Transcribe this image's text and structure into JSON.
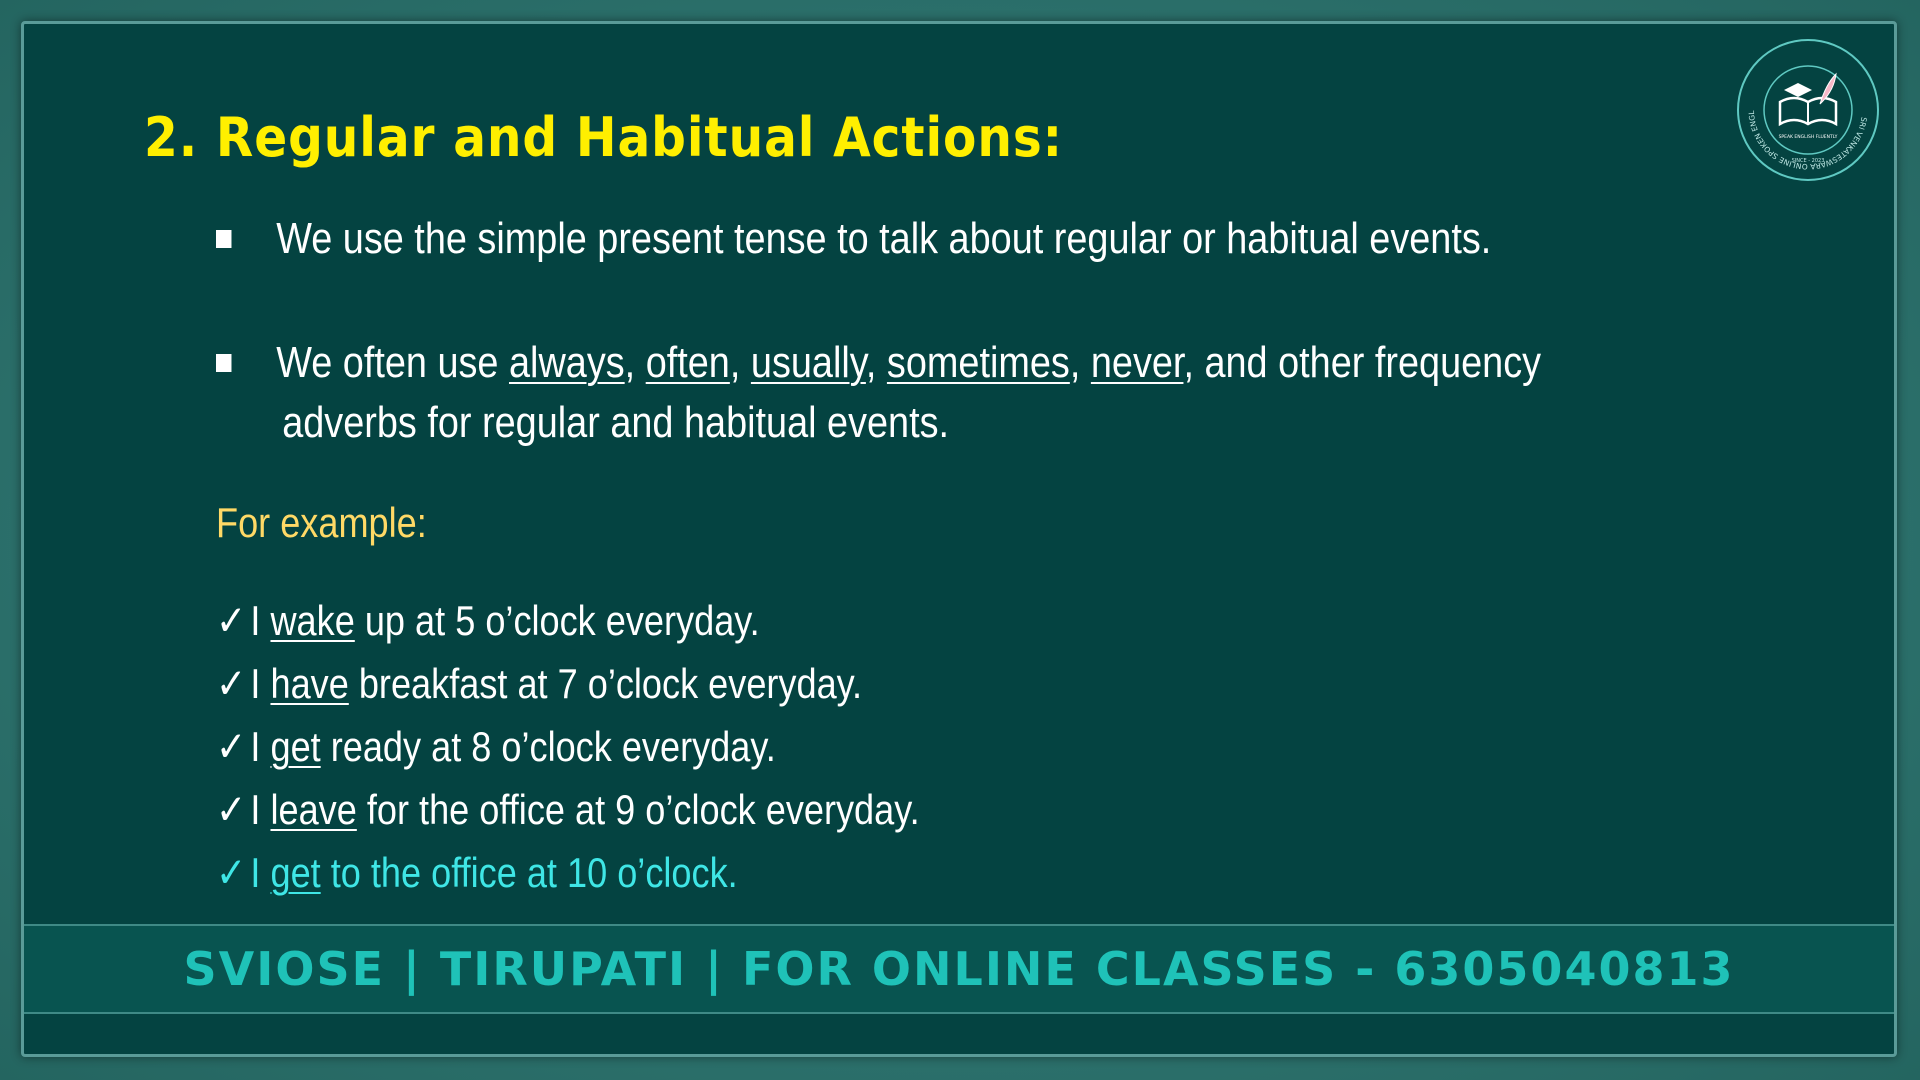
{
  "title": "2. Regular and Habitual Actions:",
  "bullets": [
    {
      "text": "We use the simple present tense to talk about regular or habitual events."
    },
    {
      "prefix": "We often use ",
      "adverbs": [
        "always",
        "often",
        "usually",
        "sometimes",
        "never"
      ],
      "suffix": ", and other frequency",
      "continuation": "adverbs for regular and habitual events."
    }
  ],
  "for_example": "For example:",
  "examples": [
    {
      "check": "✓",
      "pre": "I ",
      "verb": "wake",
      "post": " up at 5 o’clock everyday."
    },
    {
      "check": "✓",
      "pre": "I ",
      "verb": "have",
      "post": " breakfast at 7 o’clock everyday."
    },
    {
      "check": "✓",
      "pre": "I ",
      "verb": "get",
      "post": " ready at 8 o’clock everyday."
    },
    {
      "check": "✓",
      "pre": "I ",
      "verb": "leave",
      "post": " for the office at 9 o’clock everyday."
    },
    {
      "check": "✓",
      "pre": "I ",
      "verb": "get",
      "post": " to the office at 10 o’clock."
    }
  ],
  "footer": "SVIOSE | TIRUPATI | FOR ONLINE CLASSES - 6305040813",
  "logo": {
    "ring_text": "SRI VENKATESWARA ONLINE SPOKEN ENGLISH SCHOOL",
    "tagline": "SPEAK ENGLISH FLUENTLY",
    "since": "SINCE - 2023"
  },
  "colors": {
    "title": "#ffef00",
    "for_example": "#ffd966",
    "highlight": "#3fe6e6",
    "footer_text": "#1fc2b8",
    "slide_bg": "#044341"
  }
}
